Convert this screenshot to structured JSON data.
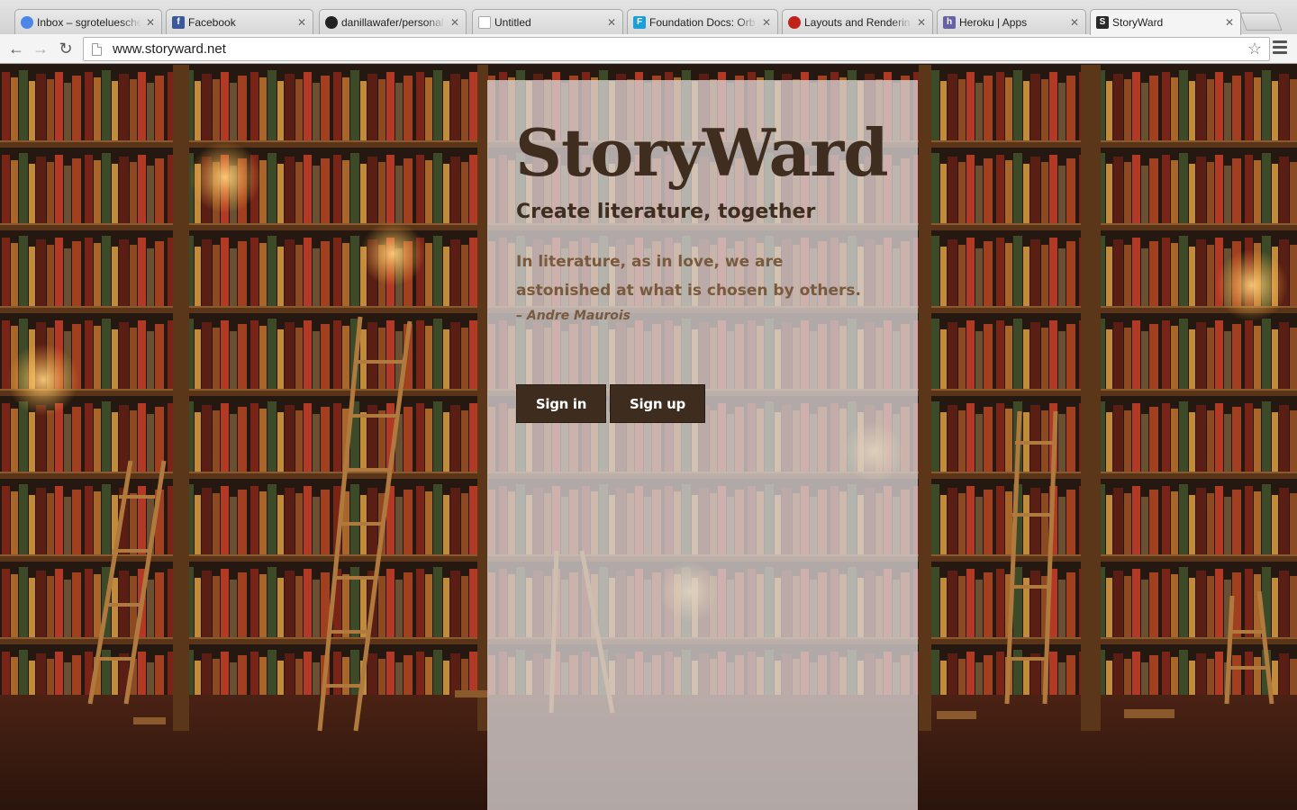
{
  "tabs": [
    {
      "title": "Inbox – sgroteluesche",
      "icon": "google-icon",
      "color": "#4a87e8",
      "active": false
    },
    {
      "title": "Facebook",
      "icon": "facebook-icon",
      "color": "#3b5998",
      "active": false
    },
    {
      "title": "danillawafer/personal",
      "icon": "github-icon",
      "color": "#222222",
      "active": false
    },
    {
      "title": "Untitled",
      "icon": "blank-page-icon",
      "color": "#ffffff",
      "active": false
    },
    {
      "title": "Foundation Docs: Orb",
      "icon": "foundation-icon",
      "color": "#1a9fd6",
      "active": false
    },
    {
      "title": "Layouts and Renderin",
      "icon": "rails-icon",
      "color": "#c0221a",
      "active": false
    },
    {
      "title": "Heroku | Apps",
      "icon": "heroku-icon",
      "color": "#6762a6",
      "active": false
    },
    {
      "title": "StoryWard",
      "icon": "storyward-icon",
      "color": "#2a2a2a",
      "active": true
    }
  ],
  "toolbar": {
    "url": "www.storyward.net"
  },
  "page": {
    "logo": "StoryWard",
    "tagline": "Create literature, together",
    "quote": "In literature, as in love, we are astonished at what is chosen by others.",
    "attribution": "– Andre Maurois",
    "signin_label": "Sign in",
    "signup_label": "Sign up"
  },
  "colors": {
    "brand_dark": "#3e2d1e",
    "quote_brown": "#7a5a3c",
    "panel": "rgba(215,210,210,0.78)"
  }
}
